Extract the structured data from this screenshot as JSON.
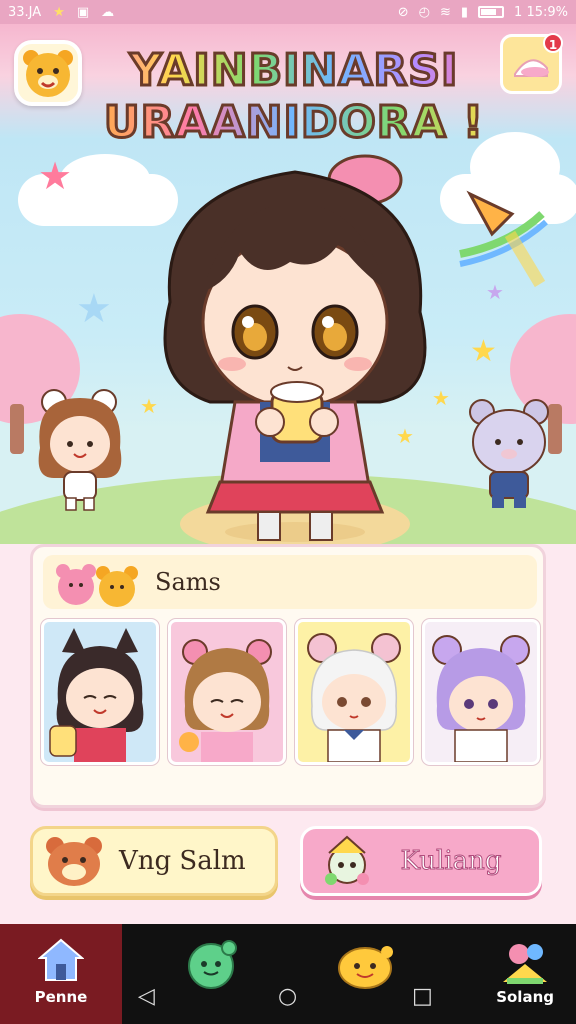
{
  "status_bar": {
    "left_text": "33.JA",
    "time": "1 15:9%"
  },
  "header": {
    "title_line1": "YAINBINARSI",
    "title_line2": "URAANIDORA !",
    "notification_count": "1"
  },
  "friends_panel": {
    "title": "Sams",
    "cards": [
      {
        "name": "cat-girl",
        "bg": "#cfe8f7"
      },
      {
        "name": "bear-girl",
        "bg": "#f8c8dc"
      },
      {
        "name": "mouse-girl",
        "bg": "#fdf1a6"
      },
      {
        "name": "lavender-girl",
        "bg": "#f6eef6"
      }
    ]
  },
  "buttons": {
    "left_label": "Vng Salm",
    "right_label": "Kuliang"
  },
  "bottom_nav": {
    "home_label": "Penne",
    "right_label": "Solang"
  },
  "colors": {
    "accent_pink": "#f7a9c9",
    "status_bar": "#e9a6c2",
    "nav_home": "#7a1b22"
  }
}
